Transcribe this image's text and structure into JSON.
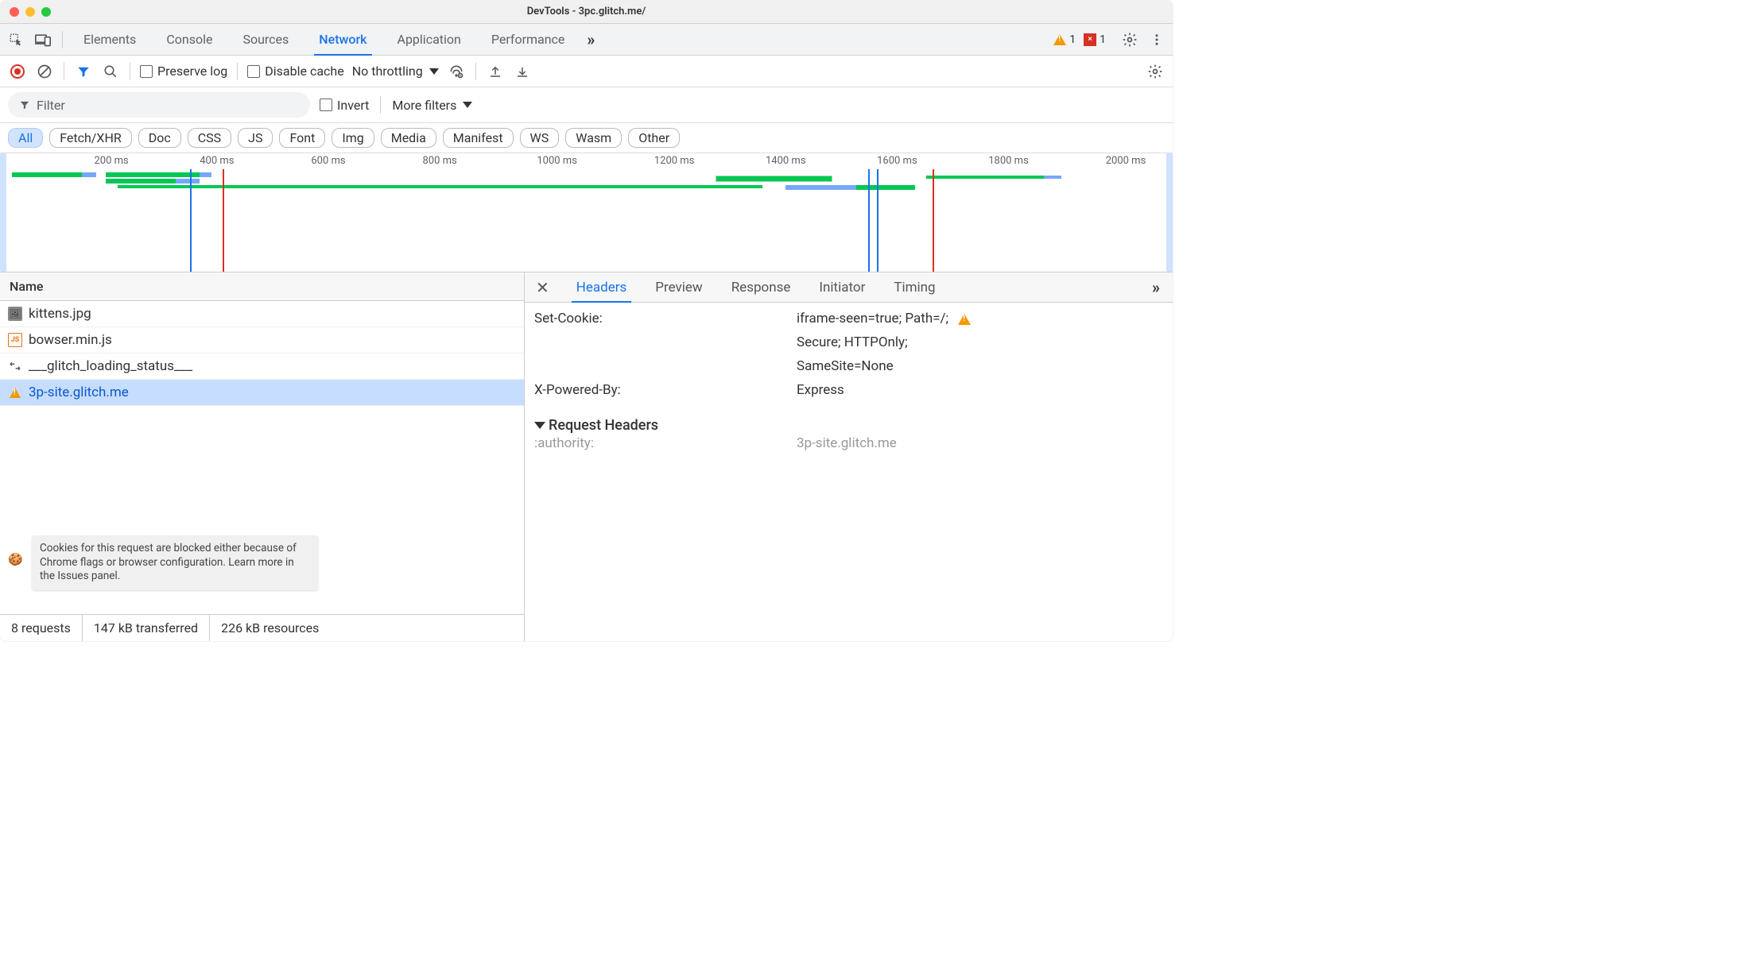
{
  "window": {
    "title": "DevTools - 3pc.glitch.me/"
  },
  "tabs": {
    "items": [
      "Elements",
      "Console",
      "Sources",
      "Network",
      "Application",
      "Performance"
    ],
    "active": "Network",
    "warnings_count": "1",
    "errors_count": "1"
  },
  "toolbar": {
    "preserve_log": "Preserve log",
    "disable_cache": "Disable cache",
    "throttling": "No throttling"
  },
  "filterbar": {
    "placeholder": "Filter",
    "invert": "Invert",
    "more_filters": "More filters"
  },
  "chips": [
    "All",
    "Fetch/XHR",
    "Doc",
    "CSS",
    "JS",
    "Font",
    "Img",
    "Media",
    "Manifest",
    "WS",
    "Wasm",
    "Other"
  ],
  "timeline_labels": [
    "200 ms",
    "400 ms",
    "600 ms",
    "800 ms",
    "1000 ms",
    "1200 ms",
    "1400 ms",
    "1600 ms",
    "1800 ms",
    "2000 ms"
  ],
  "reqlist": {
    "header": "Name",
    "items": [
      {
        "name": "kittens.jpg",
        "icon": "img"
      },
      {
        "name": "bowser.min.js",
        "icon": "js"
      },
      {
        "name": "___glitch_loading_status___",
        "icon": "xhr"
      },
      {
        "name": "3p-site.glitch.me",
        "icon": "warn",
        "selected": true
      }
    ]
  },
  "tooltip_text": "Cookies for this request are blocked either because of Chrome flags or browser configuration. Learn more in the Issues panel.",
  "statusbar": {
    "requests": "8 requests",
    "transferred": "147 kB transferred",
    "resources": "226 kB resources"
  },
  "details_tabs": [
    "Headers",
    "Preview",
    "Response",
    "Initiator",
    "Timing"
  ],
  "details_active": "Headers",
  "headers": {
    "rows": [
      {
        "name": "Set-Cookie:",
        "value": "iframe-seen=true; Path=/;",
        "warn": true
      },
      {
        "name": "",
        "value": "Secure; HTTPOnly;"
      },
      {
        "name": "",
        "value": "SameSite=None"
      },
      {
        "name": "X-Powered-By:",
        "value": "Express"
      }
    ],
    "section2": "Request Headers",
    "req_rows": [
      {
        "name": ":authority:",
        "value": "3p-site.glitch.me"
      }
    ]
  }
}
